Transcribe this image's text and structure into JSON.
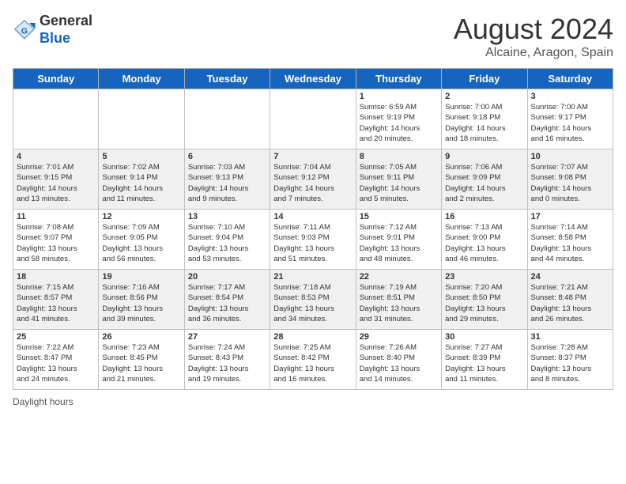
{
  "header": {
    "logo": {
      "line1": "General",
      "line2": "Blue"
    },
    "title": "August 2024",
    "subtitle": "Alcaine, Aragon, Spain"
  },
  "calendar": {
    "weekdays": [
      "Sunday",
      "Monday",
      "Tuesday",
      "Wednesday",
      "Thursday",
      "Friday",
      "Saturday"
    ],
    "weeks": [
      [
        {
          "day": "",
          "info": ""
        },
        {
          "day": "",
          "info": ""
        },
        {
          "day": "",
          "info": ""
        },
        {
          "day": "",
          "info": ""
        },
        {
          "day": "1",
          "info": "Sunrise: 6:59 AM\nSunset: 9:19 PM\nDaylight: 14 hours\nand 20 minutes."
        },
        {
          "day": "2",
          "info": "Sunrise: 7:00 AM\nSunset: 9:18 PM\nDaylight: 14 hours\nand 18 minutes."
        },
        {
          "day": "3",
          "info": "Sunrise: 7:00 AM\nSunset: 9:17 PM\nDaylight: 14 hours\nand 16 minutes."
        }
      ],
      [
        {
          "day": "4",
          "info": "Sunrise: 7:01 AM\nSunset: 9:15 PM\nDaylight: 14 hours\nand 13 minutes."
        },
        {
          "day": "5",
          "info": "Sunrise: 7:02 AM\nSunset: 9:14 PM\nDaylight: 14 hours\nand 11 minutes."
        },
        {
          "day": "6",
          "info": "Sunrise: 7:03 AM\nSunset: 9:13 PM\nDaylight: 14 hours\nand 9 minutes."
        },
        {
          "day": "7",
          "info": "Sunrise: 7:04 AM\nSunset: 9:12 PM\nDaylight: 14 hours\nand 7 minutes."
        },
        {
          "day": "8",
          "info": "Sunrise: 7:05 AM\nSunset: 9:11 PM\nDaylight: 14 hours\nand 5 minutes."
        },
        {
          "day": "9",
          "info": "Sunrise: 7:06 AM\nSunset: 9:09 PM\nDaylight: 14 hours\nand 2 minutes."
        },
        {
          "day": "10",
          "info": "Sunrise: 7:07 AM\nSunset: 9:08 PM\nDaylight: 14 hours\nand 0 minutes."
        }
      ],
      [
        {
          "day": "11",
          "info": "Sunrise: 7:08 AM\nSunset: 9:07 PM\nDaylight: 13 hours\nand 58 minutes."
        },
        {
          "day": "12",
          "info": "Sunrise: 7:09 AM\nSunset: 9:05 PM\nDaylight: 13 hours\nand 56 minutes."
        },
        {
          "day": "13",
          "info": "Sunrise: 7:10 AM\nSunset: 9:04 PM\nDaylight: 13 hours\nand 53 minutes."
        },
        {
          "day": "14",
          "info": "Sunrise: 7:11 AM\nSunset: 9:03 PM\nDaylight: 13 hours\nand 51 minutes."
        },
        {
          "day": "15",
          "info": "Sunrise: 7:12 AM\nSunset: 9:01 PM\nDaylight: 13 hours\nand 48 minutes."
        },
        {
          "day": "16",
          "info": "Sunrise: 7:13 AM\nSunset: 9:00 PM\nDaylight: 13 hours\nand 46 minutes."
        },
        {
          "day": "17",
          "info": "Sunrise: 7:14 AM\nSunset: 8:58 PM\nDaylight: 13 hours\nand 44 minutes."
        }
      ],
      [
        {
          "day": "18",
          "info": "Sunrise: 7:15 AM\nSunset: 8:57 PM\nDaylight: 13 hours\nand 41 minutes."
        },
        {
          "day": "19",
          "info": "Sunrise: 7:16 AM\nSunset: 8:56 PM\nDaylight: 13 hours\nand 39 minutes."
        },
        {
          "day": "20",
          "info": "Sunrise: 7:17 AM\nSunset: 8:54 PM\nDaylight: 13 hours\nand 36 minutes."
        },
        {
          "day": "21",
          "info": "Sunrise: 7:18 AM\nSunset: 8:53 PM\nDaylight: 13 hours\nand 34 minutes."
        },
        {
          "day": "22",
          "info": "Sunrise: 7:19 AM\nSunset: 8:51 PM\nDaylight: 13 hours\nand 31 minutes."
        },
        {
          "day": "23",
          "info": "Sunrise: 7:20 AM\nSunset: 8:50 PM\nDaylight: 13 hours\nand 29 minutes."
        },
        {
          "day": "24",
          "info": "Sunrise: 7:21 AM\nSunset: 8:48 PM\nDaylight: 13 hours\nand 26 minutes."
        }
      ],
      [
        {
          "day": "25",
          "info": "Sunrise: 7:22 AM\nSunset: 8:47 PM\nDaylight: 13 hours\nand 24 minutes."
        },
        {
          "day": "26",
          "info": "Sunrise: 7:23 AM\nSunset: 8:45 PM\nDaylight: 13 hours\nand 21 minutes."
        },
        {
          "day": "27",
          "info": "Sunrise: 7:24 AM\nSunset: 8:43 PM\nDaylight: 13 hours\nand 19 minutes."
        },
        {
          "day": "28",
          "info": "Sunrise: 7:25 AM\nSunset: 8:42 PM\nDaylight: 13 hours\nand 16 minutes."
        },
        {
          "day": "29",
          "info": "Sunrise: 7:26 AM\nSunset: 8:40 PM\nDaylight: 13 hours\nand 14 minutes."
        },
        {
          "day": "30",
          "info": "Sunrise: 7:27 AM\nSunset: 8:39 PM\nDaylight: 13 hours\nand 11 minutes."
        },
        {
          "day": "31",
          "info": "Sunrise: 7:28 AM\nSunset: 8:37 PM\nDaylight: 13 hours\nand 8 minutes."
        }
      ]
    ]
  },
  "footer": {
    "note": "Daylight hours"
  }
}
